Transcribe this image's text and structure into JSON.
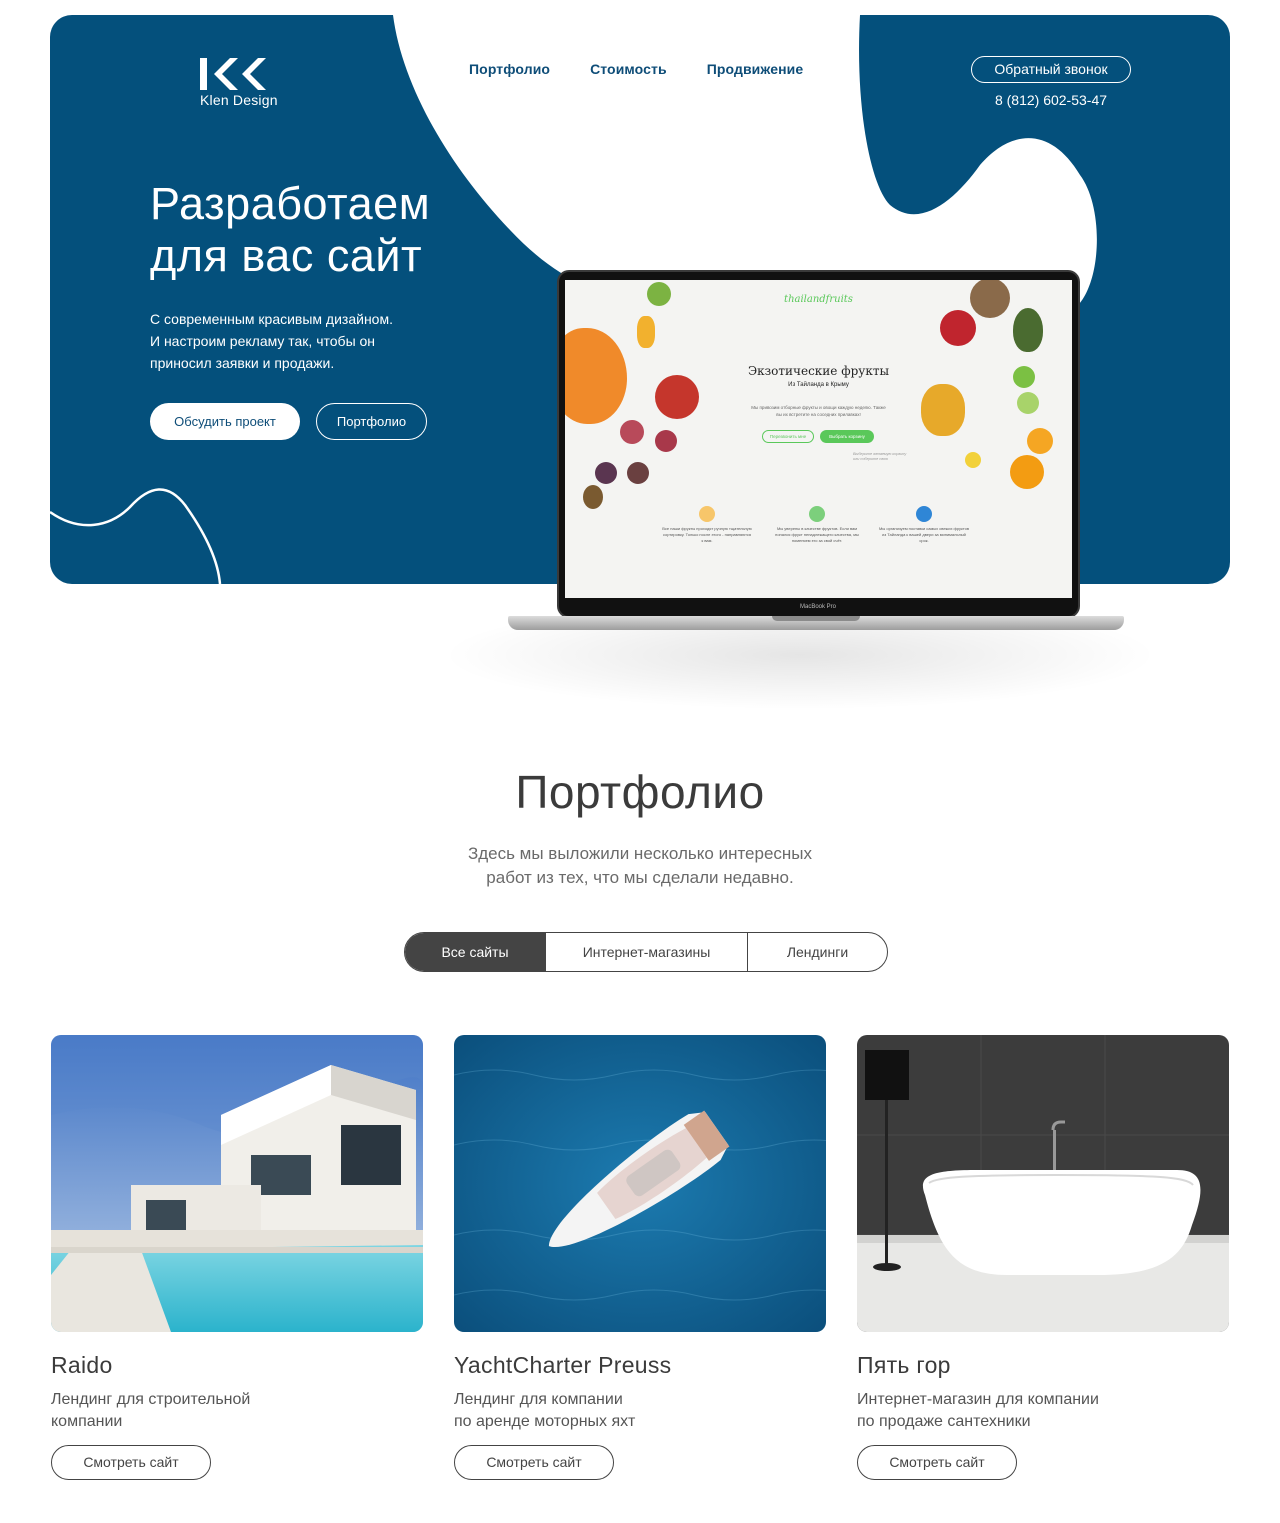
{
  "brand": {
    "logo_text": "Klen Design",
    "colors": {
      "primary": "#04507c",
      "dark": "#444444"
    }
  },
  "nav": {
    "items": [
      "Портфолио",
      "Стоимость",
      "Продвижение"
    ]
  },
  "header": {
    "callback_label": "Обратный звонок",
    "phone": "8 (812) 602-53-47"
  },
  "hero": {
    "title_line1": "Разработаем",
    "title_line2": "для вас сайт",
    "subtitle_line1": "С современным красивым дизайном.",
    "subtitle_line2": "И настроим рекламу так, чтобы он",
    "subtitle_line3": "приносил заявки и продажи.",
    "primary_button": "Обсудить проект",
    "secondary_button": "Портфолио"
  },
  "laptop": {
    "label": "MacBook Pro",
    "screen": {
      "brand": "thailandfruits",
      "title": "Экзотические фрукты",
      "subtitle": "Из Тайланда в Крыму",
      "description": "Мы привозим отборные фрукты и овощи каждую неделю. Также вы их встретите на соседних прилавках!",
      "button_1": "Перезвонить мне",
      "button_2": "Выбрать корзину",
      "note": "Выберите желаемую корзину или соберите свою",
      "features": [
        {
          "icon": "hand-heart-icon",
          "text": "Все наши фрукты проходят ручную тщательную сортировку. Только после этого - направляются к вам."
        },
        {
          "icon": "leaf-icon",
          "text": "Мы уверены в качестве фруктов. Если вам попался фрукт ненадлежащего качества, мы поменяем его за свой счёт."
        },
        {
          "icon": "plane-icon",
          "text": "Мы организуем поставки самых свежих фруктов из Тайланда к вашей двери за минимальный срок."
        }
      ]
    }
  },
  "portfolio": {
    "title": "Портфолио",
    "subtitle_line1": "Здесь мы выложили несколько интересных",
    "subtitle_line2": "работ из тех, что мы сделали недавно.",
    "filters": [
      "Все сайты",
      "Интернет-магазины",
      "Лендинги"
    ],
    "active_filter": "Все сайты",
    "cards": [
      {
        "title": "Raido",
        "desc_line1": "Лендинг для строительной",
        "desc_line2": "компании",
        "button": "Смотреть сайт",
        "image": "modern-villa-pool"
      },
      {
        "title": "YachtCharter Preuss",
        "desc_line1": "Лендинг для компании",
        "desc_line2": "по аренде моторных яхт",
        "button": "Смотреть сайт",
        "image": "motor-yacht-aerial"
      },
      {
        "title": "Пять гор",
        "desc_line1": "Интернет-магазин для компании",
        "desc_line2": "по продаже сантехники",
        "button": "Смотреть сайт",
        "image": "freestanding-bathtub"
      }
    ]
  }
}
